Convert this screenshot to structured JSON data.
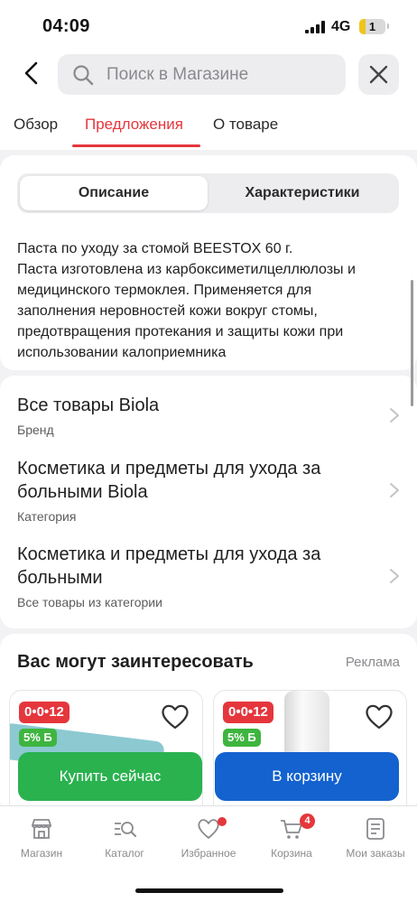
{
  "status_bar": {
    "time": "04:09",
    "network": "4G",
    "battery": "1"
  },
  "header": {
    "search_placeholder": "Поиск в Магазине",
    "tabs": [
      {
        "label": "Обзор"
      },
      {
        "label": "Предложения"
      },
      {
        "label": "О товаре"
      }
    ]
  },
  "description": {
    "segments": [
      "Описание",
      "Характеристики"
    ],
    "lines": [
      "Паста по уходу за стомой BEESTOX 60 г.",
      "Паста изготовлена из карбоксиметилцеллюлозы и",
      "медицинского термоклея. Применяется для",
      "заполнения неровностей кожи вокруг стомы,",
      "предотвращения протекания и защиты кожи при",
      "использовании калоприемника"
    ]
  },
  "links": [
    {
      "title_lines": [
        "Все товары Biola"
      ],
      "subtitle": "Бренд"
    },
    {
      "title_lines": [
        "Косметика и предметы для ухода за",
        "больными Biola"
      ],
      "subtitle": "Категория"
    },
    {
      "title_lines": [
        "Косметика и предметы для ухода за",
        "больными"
      ],
      "subtitle": "Все товары из категории"
    }
  ],
  "recommendations": {
    "title": "Вас могут заинтересовать",
    "ad_label": "Реклама",
    "products": [
      {
        "promo_badge": "0•0•12",
        "discount_badge": "5% Б"
      },
      {
        "promo_badge": "0•0•12",
        "discount_badge": "5% Б"
      }
    ]
  },
  "actions": {
    "buy_now": "Купить сейчас",
    "add_to_cart": "В корзину"
  },
  "bottom_nav": [
    {
      "label": "Магазин",
      "icon": "store-icon"
    },
    {
      "label": "Каталог",
      "icon": "catalog-search-icon"
    },
    {
      "label": "Избранное",
      "icon": "heart-icon"
    },
    {
      "label": "Корзина",
      "icon": "cart-icon",
      "badge": "4"
    },
    {
      "label": "Мои заказы",
      "icon": "orders-icon"
    }
  ],
  "colors": {
    "accent": "#e5363c",
    "buy": "#2ab24f",
    "cart": "#1462cf",
    "discount": "#3eb53f"
  }
}
